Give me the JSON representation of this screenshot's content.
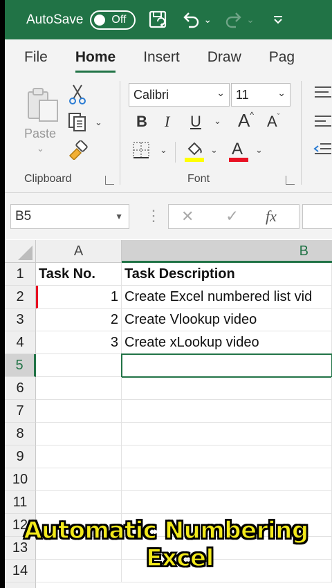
{
  "titlebar": {
    "autosave_label": "AutoSave",
    "autosave_state": "Off",
    "color": "#217346"
  },
  "tabs": [
    {
      "label": "File"
    },
    {
      "label": "Home",
      "active": true
    },
    {
      "label": "Insert"
    },
    {
      "label": "Draw"
    },
    {
      "label": "Pag"
    }
  ],
  "ribbon": {
    "clipboard": {
      "paste_label": "Paste",
      "group_label": "Clipboard"
    },
    "font": {
      "font_name": "Calibri",
      "font_size": "11",
      "group_label": "Font",
      "bold": "B",
      "italic": "I",
      "underline": "U",
      "highlight_color": "#ffff00",
      "font_color": "#e81123"
    }
  },
  "formula_bar": {
    "name_box": "B5",
    "fx": "fx",
    "cancel": "✕",
    "enter": "✓",
    "dots": "⋮"
  },
  "sheet": {
    "columns": [
      "A",
      "B"
    ],
    "rows": [
      "1",
      "2",
      "3",
      "4",
      "5",
      "6",
      "7",
      "8",
      "9",
      "10",
      "11",
      "12",
      "13",
      "14"
    ],
    "headers": {
      "a": "Task No.",
      "b": "Task Description"
    },
    "data": [
      {
        "no": "1",
        "desc": "Create Excel numbered list vid"
      },
      {
        "no": "2",
        "desc": "Create Vlookup video"
      },
      {
        "no": "3",
        "desc": "Create xLookup video"
      }
    ],
    "active_cell": "B5"
  },
  "caption": {
    "line1": "Automatic Numbering",
    "line2": "Excel"
  }
}
